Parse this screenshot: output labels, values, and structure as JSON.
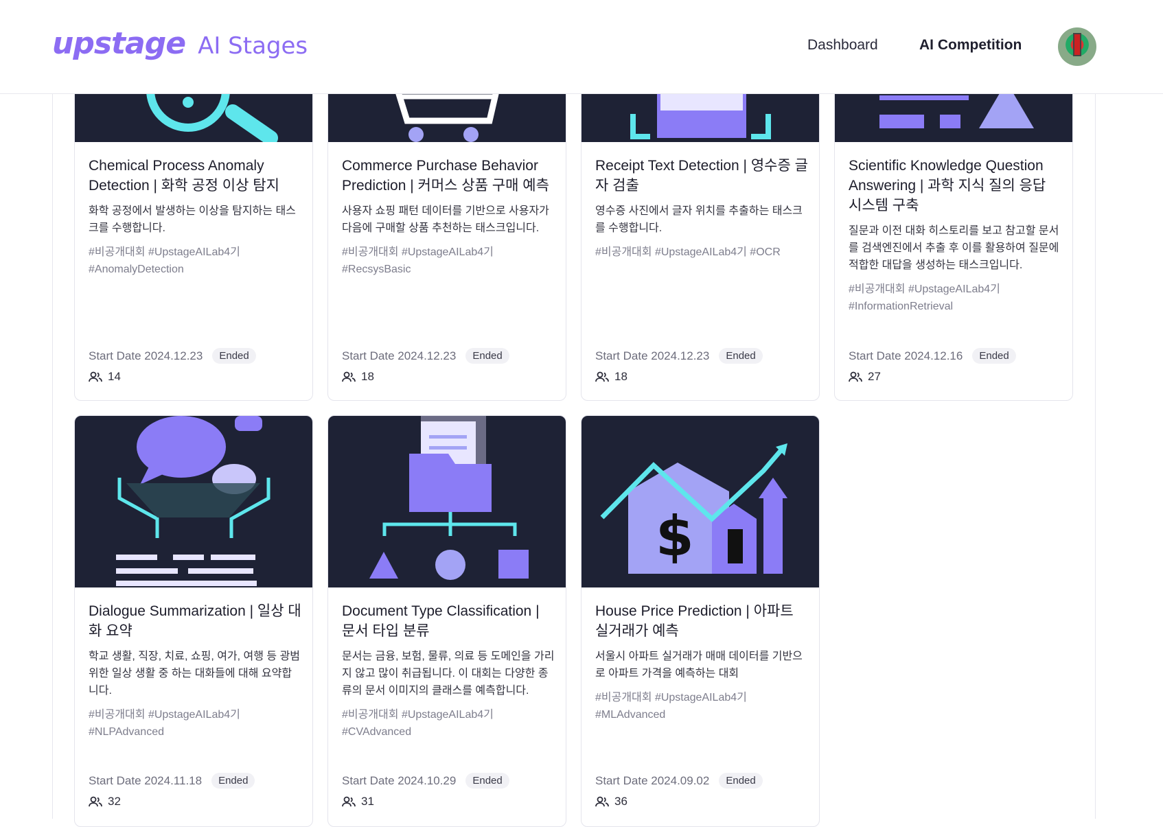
{
  "header": {
    "logo": "upstage",
    "logo_sub": "AI Stages",
    "nav": {
      "dashboard": "Dashboard",
      "competition": "AI Competition"
    }
  },
  "cards": [
    {
      "title": "Chemical Process Anomaly Detection | 화학 공정 이상 탐지",
      "desc": "화학 공정에서 발생하는 이상을 탐지하는 태스크를 수행합니다.",
      "tags": "#비공개대회 #UpstageAILab4기 #AnomalyDetection",
      "start": "Start Date 2024.12.23",
      "status": "Ended",
      "participants": "14"
    },
    {
      "title": "Commerce Purchase Behavior Prediction | 커머스 상품 구매 예측",
      "desc": "사용자 쇼핑 패턴 데이터를 기반으로 사용자가 다음에 구매할 상품 추천하는 태스크입니다.",
      "tags": "#비공개대회 #UpstageAILab4기 #RecsysBasic",
      "start": "Start Date 2024.12.23",
      "status": "Ended",
      "participants": "18"
    },
    {
      "title": "Receipt Text Detection | 영수증 글자 검출",
      "desc": "영수증 사진에서 글자 위치를 추출하는 태스크를 수행합니다.",
      "tags": "#비공개대회 #UpstageAILab4기 #OCR",
      "start": "Start Date 2024.12.23",
      "status": "Ended",
      "participants": "18"
    },
    {
      "title": "Scientific Knowledge Question Answering | 과학 지식 질의 응답 시스템 구축",
      "desc": "질문과 이전 대화 히스토리를 보고 참고할 문서를 검색엔진에서 추출 후 이를 활용하여 질문에 적합한 대답을 생성하는 태스크입니다.",
      "tags": "#비공개대회 #UpstageAILab4기 #InformationRetrieval",
      "start": "Start Date 2024.12.16",
      "status": "Ended",
      "participants": "27"
    },
    {
      "title": "Dialogue Summarization | 일상 대화 요약",
      "desc": "학교 생활, 직장, 치료, 쇼핑, 여가, 여행 등 광범위한 일상 생활 중 하는 대화들에 대해 요약합니다.",
      "tags": "#비공개대회 #UpstageAILab4기 #NLPAdvanced",
      "start": "Start Date 2024.11.18",
      "status": "Ended",
      "participants": "32"
    },
    {
      "title": "Document Type Classification | 문서 타입 분류",
      "desc": "문서는 금융, 보험, 물류, 의료 등 도메인을 가리지 않고 많이 취급됩니다. 이 대회는 다양한 종류의 문서 이미지의 클래스를 예측합니다.",
      "tags": "#비공개대회 #UpstageAILab4기 #CVAdvanced",
      "start": "Start Date 2024.10.29",
      "status": "Ended",
      "participants": "31"
    },
    {
      "title": "House Price Prediction | 아파트 실거래가 예측",
      "desc": "서울시 아파트 실거래가 매매 데이터를 기반으로 아파트 가격을 예측하는 대회",
      "tags": "#비공개대회 #UpstageAILab4기 #MLAdvanced",
      "start": "Start Date 2024.09.02",
      "status": "Ended",
      "participants": "36"
    }
  ]
}
